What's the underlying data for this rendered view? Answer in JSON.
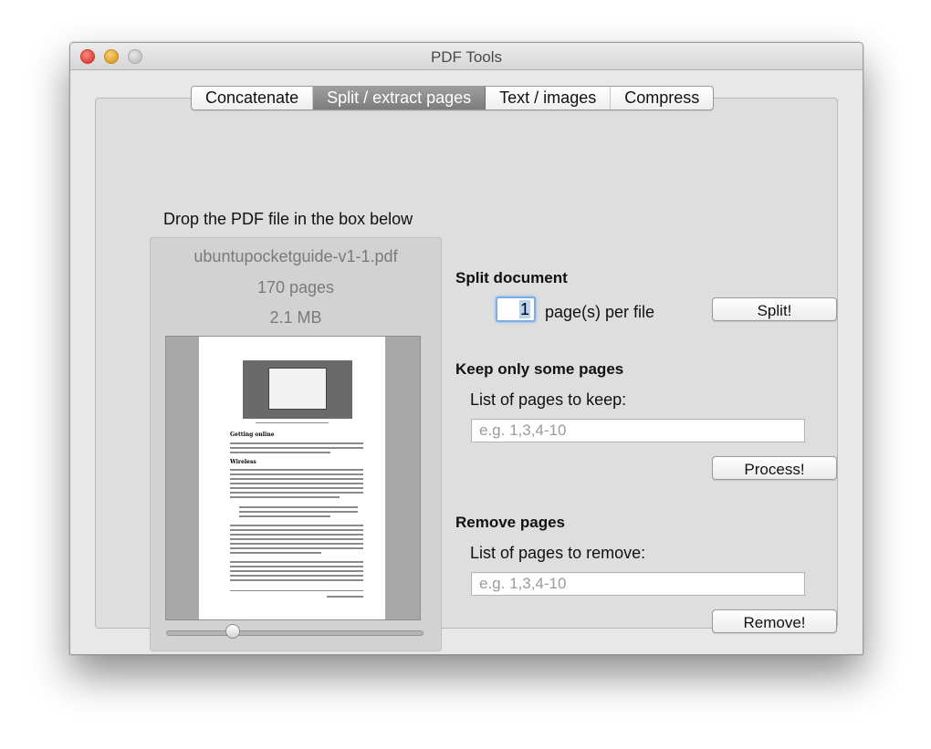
{
  "window": {
    "title": "PDF Tools"
  },
  "tabs": [
    {
      "label": "Concatenate",
      "active": false
    },
    {
      "label": "Split / extract pages",
      "active": true
    },
    {
      "label": "Text / images",
      "active": false
    },
    {
      "label": "Compress",
      "active": false
    }
  ],
  "drop": {
    "instruction": "Drop the PDF file in the box below",
    "filename": "ubuntupocketguide-v1-1.pdf",
    "pages": "170 pages",
    "size": "2.1 MB"
  },
  "split": {
    "heading": "Split document",
    "pages_per_file": "1",
    "suffix_label": "page(s) per file",
    "button": "Split!"
  },
  "keep": {
    "heading": "Keep only some pages",
    "label": "List of pages to keep:",
    "placeholder": "e.g. 1,3,4-10",
    "button": "Process!"
  },
  "remove": {
    "heading": "Remove pages",
    "label": "List of pages to remove:",
    "placeholder": "e.g. 1,3,4-10",
    "button": "Remove!"
  },
  "colors": {
    "active_tab": "#8a8a8a",
    "focus_ring": "#7aaee8"
  }
}
